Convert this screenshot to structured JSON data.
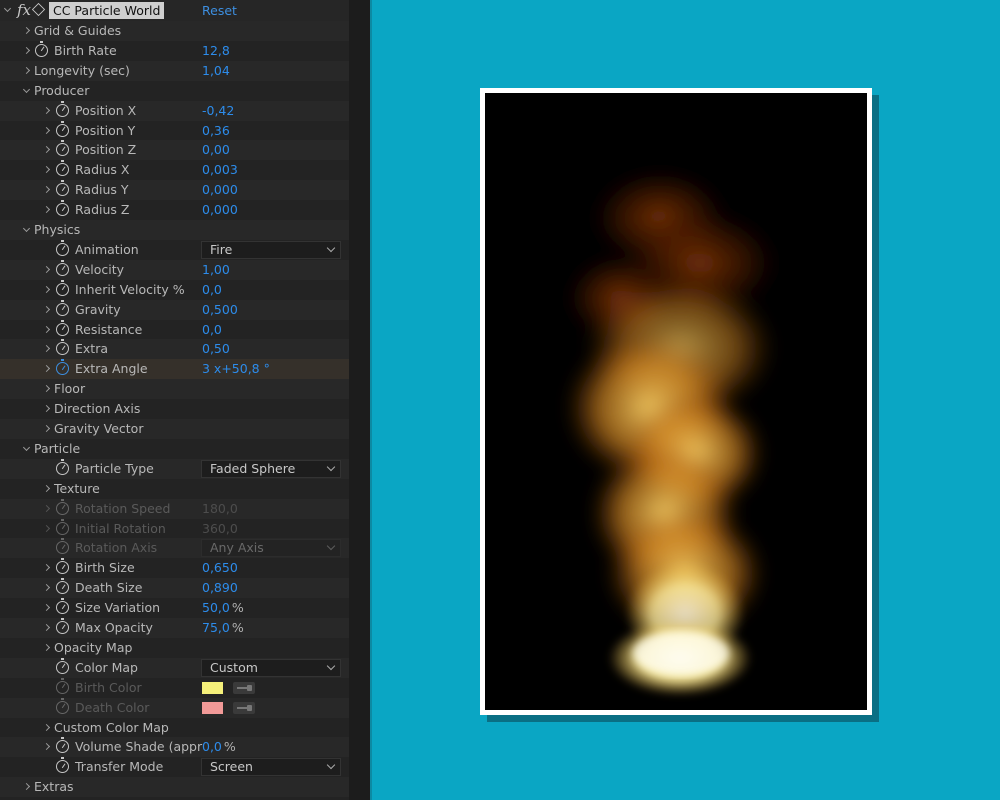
{
  "effect": {
    "fx_icon": "fx",
    "name": "CC Particle World",
    "reset_label": "Reset",
    "icons": [
      "fx-icon",
      "cube-icon",
      "stopwatch-icon",
      "chevron-right-icon",
      "chevron-down-icon",
      "eyedropper-icon"
    ]
  },
  "rows": [
    {
      "type": "group",
      "level": 0,
      "label": "Grid & Guides"
    },
    {
      "type": "prop",
      "level": 0,
      "label": "Birth Rate",
      "value": "12,8"
    },
    {
      "type": "prop",
      "level": 0,
      "label": "Longevity (sec)",
      "value": "1,04",
      "nostopwatch": true
    },
    {
      "type": "group",
      "level": 0,
      "label": "Producer",
      "open": true
    },
    {
      "type": "prop",
      "level": 1,
      "label": "Position X",
      "value": "-0,42"
    },
    {
      "type": "prop",
      "level": 1,
      "label": "Position Y",
      "value": "0,36"
    },
    {
      "type": "prop",
      "level": 1,
      "label": "Position Z",
      "value": "0,00"
    },
    {
      "type": "prop",
      "level": 1,
      "label": "Radius X",
      "value": "0,003"
    },
    {
      "type": "prop",
      "level": 1,
      "label": "Radius Y",
      "value": "0,000"
    },
    {
      "type": "prop",
      "level": 1,
      "label": "Radius Z",
      "value": "0,000"
    },
    {
      "type": "group",
      "level": 0,
      "label": "Physics",
      "open": true
    },
    {
      "type": "dropdown",
      "level": 1,
      "label": "Animation",
      "value": "Fire",
      "notwirl": true
    },
    {
      "type": "prop",
      "level": 1,
      "label": "Velocity",
      "value": "1,00"
    },
    {
      "type": "prop",
      "level": 1,
      "label": "Inherit Velocity %",
      "value": "0,0"
    },
    {
      "type": "prop",
      "level": 1,
      "label": "Gravity",
      "value": "0,500"
    },
    {
      "type": "prop",
      "level": 1,
      "label": "Resistance",
      "value": "0,0"
    },
    {
      "type": "prop",
      "level": 1,
      "label": "Extra",
      "value": "0,50"
    },
    {
      "type": "prop",
      "level": 1,
      "label": "Extra Angle",
      "value": "3 x+50,8 °",
      "active": true
    },
    {
      "type": "group",
      "level": 1,
      "label": "Floor"
    },
    {
      "type": "group",
      "level": 1,
      "label": "Direction Axis"
    },
    {
      "type": "group",
      "level": 1,
      "label": "Gravity Vector"
    },
    {
      "type": "group",
      "level": 0,
      "label": "Particle",
      "open": true
    },
    {
      "type": "dropdown",
      "level": 1,
      "label": "Particle Type",
      "value": "Faded Sphere",
      "notwirl": true
    },
    {
      "type": "group",
      "level": 1,
      "label": "Texture"
    },
    {
      "type": "prop",
      "level": 1,
      "label": "Rotation Speed",
      "value": "180,0",
      "disabled": true
    },
    {
      "type": "prop",
      "level": 1,
      "label": "Initial Rotation",
      "value": "360,0",
      "disabled": true
    },
    {
      "type": "dropdown",
      "level": 1,
      "label": "Rotation Axis",
      "value": "Any Axis",
      "disabled": true,
      "notwirl": true
    },
    {
      "type": "prop",
      "level": 1,
      "label": "Birth Size",
      "value": "0,650"
    },
    {
      "type": "prop",
      "level": 1,
      "label": "Death Size",
      "value": "0,890"
    },
    {
      "type": "prop",
      "level": 1,
      "label": "Size Variation",
      "value": "50,0",
      "unit": "%"
    },
    {
      "type": "prop",
      "level": 1,
      "label": "Max Opacity",
      "value": "75,0",
      "unit": "%"
    },
    {
      "type": "group",
      "level": 1,
      "label": "Opacity Map"
    },
    {
      "type": "dropdown",
      "level": 1,
      "label": "Color Map",
      "value": "Custom",
      "notwirl": true
    },
    {
      "type": "color",
      "level": 1,
      "label": "Birth Color",
      "color": "#f5f07a",
      "disabled": true
    },
    {
      "type": "color",
      "level": 1,
      "label": "Death Color",
      "color": "#f29a98",
      "disabled": true
    },
    {
      "type": "group",
      "level": 1,
      "label": "Custom Color Map"
    },
    {
      "type": "prop",
      "level": 1,
      "label": "Volume Shade (appr",
      "value": "0,0",
      "unit": "%"
    },
    {
      "type": "dropdown",
      "level": 1,
      "label": "Transfer Mode",
      "value": "Screen",
      "notwirl": true
    },
    {
      "type": "group",
      "level": 0,
      "label": "Extras"
    }
  ],
  "composition": {
    "background": "#000000",
    "frame_color": "#ffffff",
    "canvas_color": "#0aa6c4",
    "shadow_color": "#0a6f84",
    "accent_blue": "#2d8ceb"
  }
}
